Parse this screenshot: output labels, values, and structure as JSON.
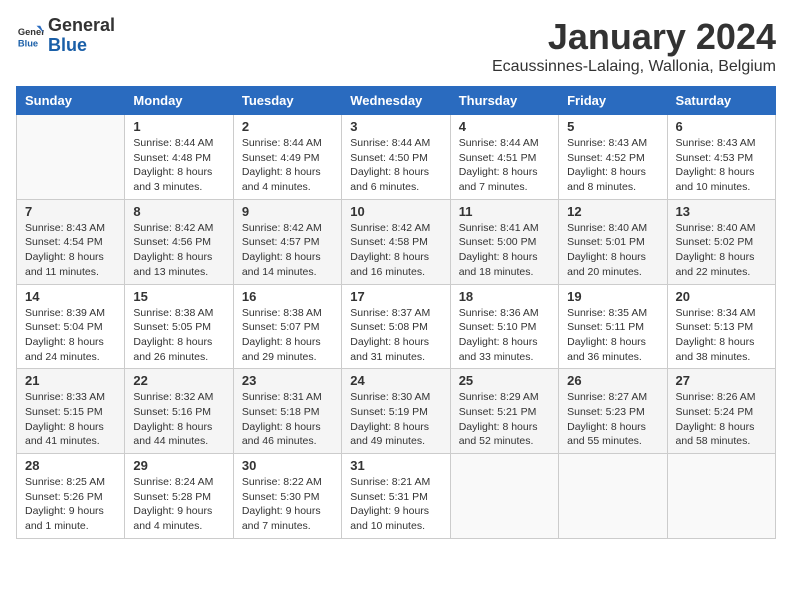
{
  "logo": {
    "general": "General",
    "blue": "Blue"
  },
  "header": {
    "month_title": "January 2024",
    "location": "Ecaussinnes-Lalaing, Wallonia, Belgium"
  },
  "days_of_week": [
    "Sunday",
    "Monday",
    "Tuesday",
    "Wednesday",
    "Thursday",
    "Friday",
    "Saturday"
  ],
  "weeks": [
    [
      {
        "day": "",
        "info": ""
      },
      {
        "day": "1",
        "info": "Sunrise: 8:44 AM\nSunset: 4:48 PM\nDaylight: 8 hours\nand 3 minutes."
      },
      {
        "day": "2",
        "info": "Sunrise: 8:44 AM\nSunset: 4:49 PM\nDaylight: 8 hours\nand 4 minutes."
      },
      {
        "day": "3",
        "info": "Sunrise: 8:44 AM\nSunset: 4:50 PM\nDaylight: 8 hours\nand 6 minutes."
      },
      {
        "day": "4",
        "info": "Sunrise: 8:44 AM\nSunset: 4:51 PM\nDaylight: 8 hours\nand 7 minutes."
      },
      {
        "day": "5",
        "info": "Sunrise: 8:43 AM\nSunset: 4:52 PM\nDaylight: 8 hours\nand 8 minutes."
      },
      {
        "day": "6",
        "info": "Sunrise: 8:43 AM\nSunset: 4:53 PM\nDaylight: 8 hours\nand 10 minutes."
      }
    ],
    [
      {
        "day": "7",
        "info": "Sunrise: 8:43 AM\nSunset: 4:54 PM\nDaylight: 8 hours\nand 11 minutes."
      },
      {
        "day": "8",
        "info": "Sunrise: 8:42 AM\nSunset: 4:56 PM\nDaylight: 8 hours\nand 13 minutes."
      },
      {
        "day": "9",
        "info": "Sunrise: 8:42 AM\nSunset: 4:57 PM\nDaylight: 8 hours\nand 14 minutes."
      },
      {
        "day": "10",
        "info": "Sunrise: 8:42 AM\nSunset: 4:58 PM\nDaylight: 8 hours\nand 16 minutes."
      },
      {
        "day": "11",
        "info": "Sunrise: 8:41 AM\nSunset: 5:00 PM\nDaylight: 8 hours\nand 18 minutes."
      },
      {
        "day": "12",
        "info": "Sunrise: 8:40 AM\nSunset: 5:01 PM\nDaylight: 8 hours\nand 20 minutes."
      },
      {
        "day": "13",
        "info": "Sunrise: 8:40 AM\nSunset: 5:02 PM\nDaylight: 8 hours\nand 22 minutes."
      }
    ],
    [
      {
        "day": "14",
        "info": "Sunrise: 8:39 AM\nSunset: 5:04 PM\nDaylight: 8 hours\nand 24 minutes."
      },
      {
        "day": "15",
        "info": "Sunrise: 8:38 AM\nSunset: 5:05 PM\nDaylight: 8 hours\nand 26 minutes."
      },
      {
        "day": "16",
        "info": "Sunrise: 8:38 AM\nSunset: 5:07 PM\nDaylight: 8 hours\nand 29 minutes."
      },
      {
        "day": "17",
        "info": "Sunrise: 8:37 AM\nSunset: 5:08 PM\nDaylight: 8 hours\nand 31 minutes."
      },
      {
        "day": "18",
        "info": "Sunrise: 8:36 AM\nSunset: 5:10 PM\nDaylight: 8 hours\nand 33 minutes."
      },
      {
        "day": "19",
        "info": "Sunrise: 8:35 AM\nSunset: 5:11 PM\nDaylight: 8 hours\nand 36 minutes."
      },
      {
        "day": "20",
        "info": "Sunrise: 8:34 AM\nSunset: 5:13 PM\nDaylight: 8 hours\nand 38 minutes."
      }
    ],
    [
      {
        "day": "21",
        "info": "Sunrise: 8:33 AM\nSunset: 5:15 PM\nDaylight: 8 hours\nand 41 minutes."
      },
      {
        "day": "22",
        "info": "Sunrise: 8:32 AM\nSunset: 5:16 PM\nDaylight: 8 hours\nand 44 minutes."
      },
      {
        "day": "23",
        "info": "Sunrise: 8:31 AM\nSunset: 5:18 PM\nDaylight: 8 hours\nand 46 minutes."
      },
      {
        "day": "24",
        "info": "Sunrise: 8:30 AM\nSunset: 5:19 PM\nDaylight: 8 hours\nand 49 minutes."
      },
      {
        "day": "25",
        "info": "Sunrise: 8:29 AM\nSunset: 5:21 PM\nDaylight: 8 hours\nand 52 minutes."
      },
      {
        "day": "26",
        "info": "Sunrise: 8:27 AM\nSunset: 5:23 PM\nDaylight: 8 hours\nand 55 minutes."
      },
      {
        "day": "27",
        "info": "Sunrise: 8:26 AM\nSunset: 5:24 PM\nDaylight: 8 hours\nand 58 minutes."
      }
    ],
    [
      {
        "day": "28",
        "info": "Sunrise: 8:25 AM\nSunset: 5:26 PM\nDaylight: 9 hours\nand 1 minute."
      },
      {
        "day": "29",
        "info": "Sunrise: 8:24 AM\nSunset: 5:28 PM\nDaylight: 9 hours\nand 4 minutes."
      },
      {
        "day": "30",
        "info": "Sunrise: 8:22 AM\nSunset: 5:30 PM\nDaylight: 9 hours\nand 7 minutes."
      },
      {
        "day": "31",
        "info": "Sunrise: 8:21 AM\nSunset: 5:31 PM\nDaylight: 9 hours\nand 10 minutes."
      },
      {
        "day": "",
        "info": ""
      },
      {
        "day": "",
        "info": ""
      },
      {
        "day": "",
        "info": ""
      }
    ]
  ]
}
